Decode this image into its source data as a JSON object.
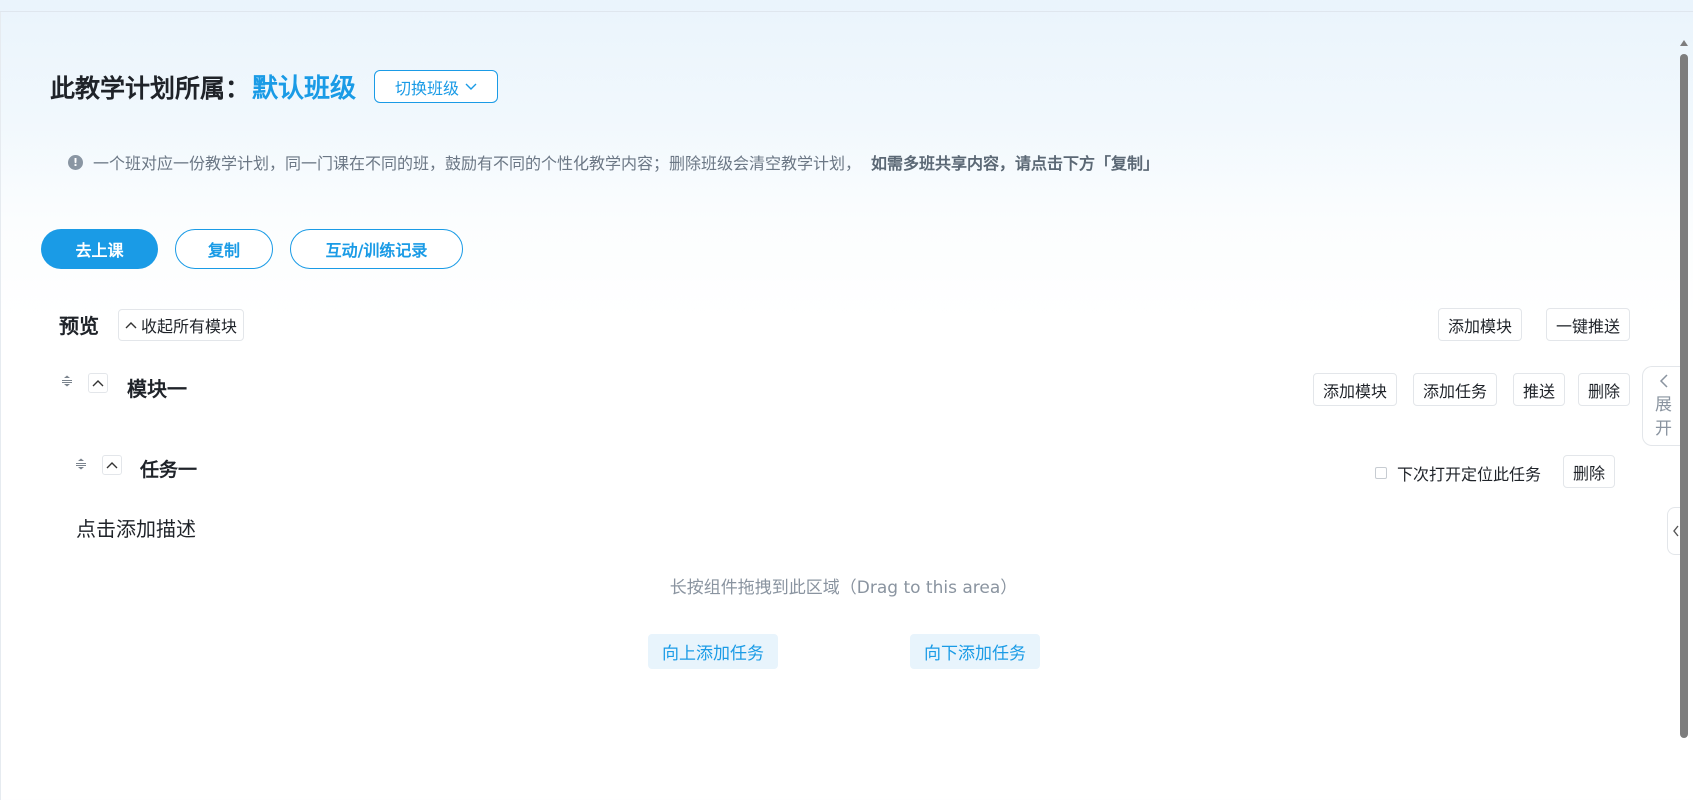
{
  "header": {
    "label": "此教学计划所属：",
    "class_name": "默认班级",
    "switch_label": "切换班级"
  },
  "notice": {
    "icon": "exclamation-icon",
    "text": "一个班对应一份教学计划，同一门课在不同的班，鼓励有不同的个性化教学内容；删除班级会清空教学计划，",
    "bold_text": "如需多班共享内容，请点击下方「复制」"
  },
  "actions": {
    "go_class": "去上课",
    "copy": "复制",
    "records": "互动/训练记录"
  },
  "preview": {
    "title": "预览",
    "collapse_all": "收起所有模块",
    "add_module": "添加模块",
    "push_all": "一键推送"
  },
  "module": {
    "title": "模块一",
    "add_module": "添加模块",
    "add_task": "添加任务",
    "push": "推送",
    "delete": "删除"
  },
  "task": {
    "title": "任务一",
    "locate_label": "下次打开定位此任务",
    "locate_checked": false,
    "delete": "删除",
    "description_placeholder": "点击添加描述",
    "drop_hint": "长按组件拖拽到此区域（Drag to this area）",
    "add_above": "向上添加任务",
    "add_below": "向下添加任务"
  },
  "side_panel": {
    "expand_label_1": "展",
    "expand_label_2": "开"
  },
  "colors": {
    "accent": "#1a9be6",
    "text": "#1f2329",
    "muted": "#8a94a0"
  }
}
